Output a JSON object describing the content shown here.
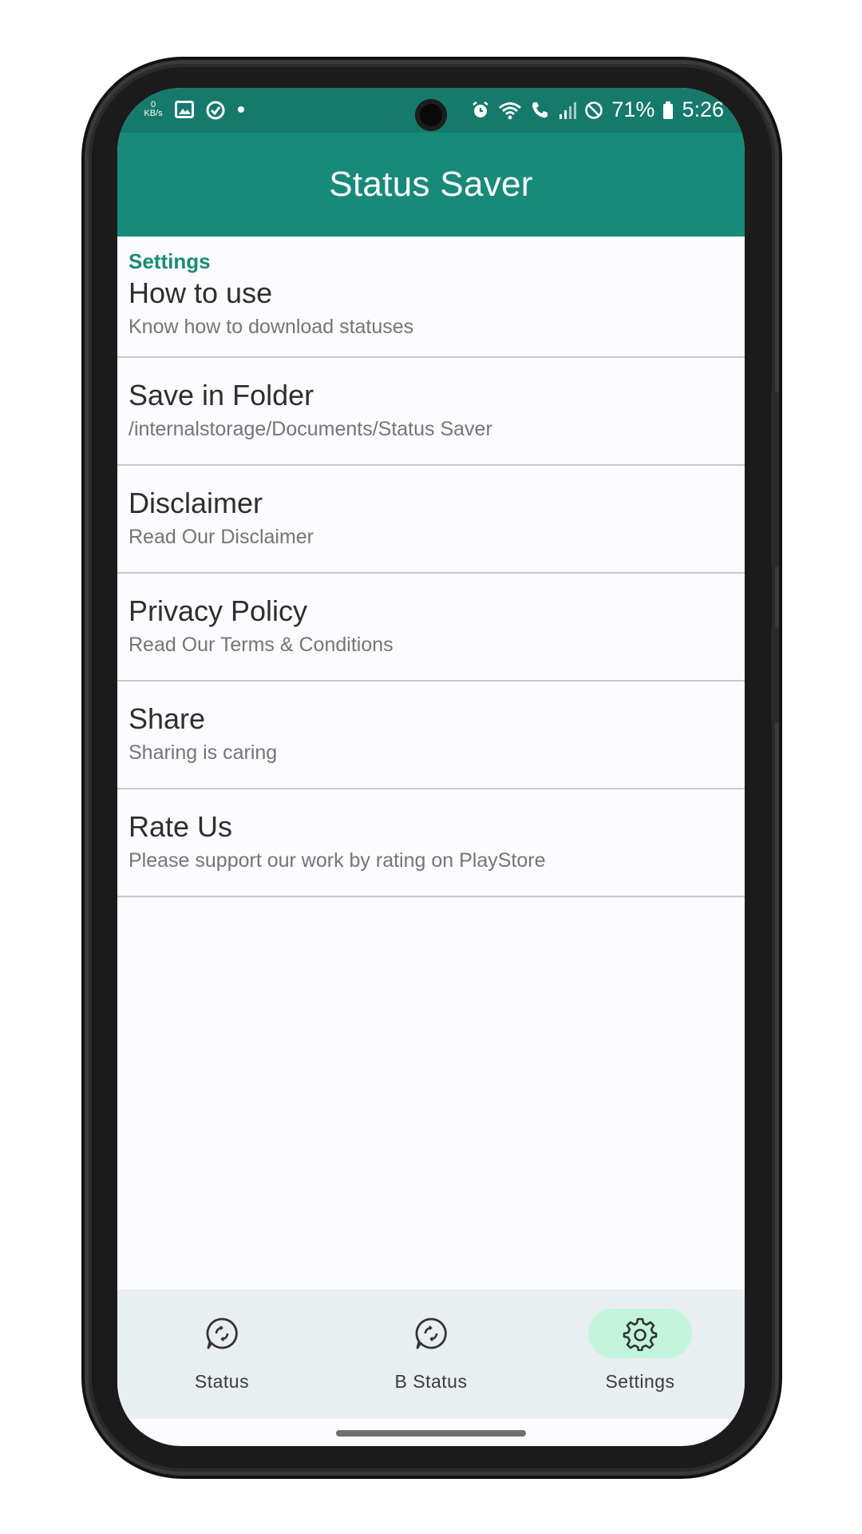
{
  "status_bar": {
    "net_speed_value": "0",
    "net_speed_unit": "KB/s",
    "battery": "71%",
    "time": "5:26",
    "left_icons": [
      "image-icon",
      "check-circle-icon",
      "dot-icon"
    ],
    "right_icons": [
      "alarm-icon",
      "wifi-icon",
      "call-icon",
      "signal-icon",
      "do-not-disturb-icon",
      "battery-icon"
    ]
  },
  "app_bar": {
    "title": "Status Saver"
  },
  "settings": {
    "section_label": "Settings",
    "items": [
      {
        "title": "How to use",
        "subtitle": "Know how to download statuses"
      },
      {
        "title": "Save in Folder",
        "subtitle": "/internalstorage/Documents/Status Saver"
      },
      {
        "title": "Disclaimer",
        "subtitle": "Read Our Disclaimer"
      },
      {
        "title": "Privacy Policy",
        "subtitle": "Read Our Terms & Conditions"
      },
      {
        "title": "Share",
        "subtitle": "Sharing is caring"
      },
      {
        "title": "Rate Us",
        "subtitle": "Please support our work by rating on PlayStore"
      }
    ]
  },
  "bottom_nav": {
    "items": [
      {
        "label": "Status",
        "icon": "whatsapp-status-icon",
        "active": false
      },
      {
        "label": "B Status",
        "icon": "whatsapp-status-icon",
        "active": false
      },
      {
        "label": "Settings",
        "icon": "gear-icon",
        "active": true
      }
    ]
  },
  "colors": {
    "status_bar_bg": "#157a6c",
    "app_bar_bg": "#188a7a",
    "accent_text": "#198a78",
    "active_nav_pill": "#c2f5dc",
    "nav_bg": "#e9eef1"
  }
}
